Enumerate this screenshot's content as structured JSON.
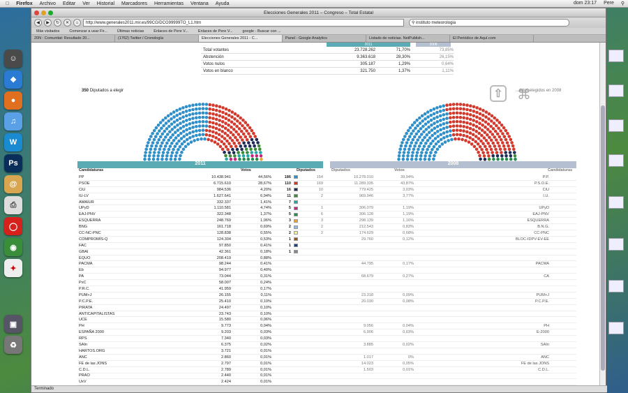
{
  "menubar": {
    "apple": "",
    "app": "Firefox",
    "items": [
      "Archivo",
      "Editar",
      "Ver",
      "Historial",
      "Marcadores",
      "Herramientas",
      "Ventana",
      "Ayuda"
    ],
    "clock": "dom 23:17",
    "user": "Pere"
  },
  "window": {
    "title": "Elecciones Generales 2011 – Congreso – Total Estatal",
    "url": "http://www.generales2011.mir.es/99CG/DCG99999TO_L1.htm",
    "search_value": "instituto meteorologia"
  },
  "bookmarks": [
    "Más visitados",
    "Comenzar a usar Fir...",
    "Últimas noticias",
    "Enlaces de Pere V...",
    "Enlaces de Pere V...",
    "google - Buscar con ..."
  ],
  "tabs": [
    "20N : Comunitat: Resultado 20...",
    "(1762) Twitter / Cronología",
    "Elecciones Generales 2011 - C...",
    "Panel - Google Analytics",
    "Listado de noticias. NetPublish...",
    "El Periódico de Aquí.com"
  ],
  "status": "Terminado",
  "summary": {
    "header_2011": "2011",
    "header_2008": "2008",
    "rows": [
      {
        "label": "Total votantes",
        "votes": "23.728.262",
        "pct": "71,70%",
        "pct08": "73,85%"
      },
      {
        "label": "Abstención",
        "votes": "9.363.618",
        "pct": "28,30%",
        "pct08": "26,15%"
      },
      {
        "label": "Votos nulos",
        "votes": "305.187",
        "pct": "1,29%",
        "pct08": "0,64%"
      },
      {
        "label": "Votos en blanco",
        "votes": "321.750",
        "pct": "1,37%",
        "pct08": "1,11%"
      }
    ]
  },
  "seats_label_num": "350",
  "seats_label_text": "Diputados a elegir",
  "seats_label_2008": "...ados elegidos en 2008",
  "table": {
    "year_2011": "2011",
    "year_2008": "2008",
    "col_party": "Candidaturas",
    "col_votes": "Votos",
    "col_seats": "Diputados",
    "col_seats08": "Diputados",
    "col_votes08": "Votos",
    "col_party08": "Candidaturas",
    "rows": [
      {
        "n": "PP",
        "v": "10.438.941",
        "p": "44,56%",
        "s": "186",
        "c": "#2f8fc9",
        "s8": "154",
        "v8": "10.278.010",
        "p8": "39,94%",
        "n8": "P.P."
      },
      {
        "n": "PSOE",
        "v": "6.715.610",
        "p": "28,67%",
        "s": "110",
        "c": "#d23a2e",
        "s8": "169",
        "v8": "11.289.335",
        "p8": "43,87%",
        "n8": "P.S.O.E."
      },
      {
        "n": "CiU",
        "v": "984.536",
        "p": "4,20%",
        "s": "16",
        "c": "#1d2b55",
        "s8": "10",
        "v8": "779.425",
        "p8": "3,03%",
        "n8": "CiU"
      },
      {
        "n": "IU-LV",
        "v": "1.627.641",
        "p": "6,94%",
        "s": "11",
        "c": "#3b8a38",
        "s8": "2",
        "v8": "969.946",
        "p8": "3,77%",
        "n8": "I.U."
      },
      {
        "n": "AMAIUR",
        "v": "332.337",
        "p": "1,41%",
        "s": "7",
        "c": "#22a6a6",
        "s8": "",
        "v8": "",
        "p8": "",
        "n8": ""
      },
      {
        "n": "UPyD",
        "v": "1.110.581",
        "p": "4,74%",
        "s": "5",
        "c": "#c4267e",
        "s8": "1",
        "v8": "306.079",
        "p8": "1,19%",
        "n8": "UPyD"
      },
      {
        "n": "EAJ-PNV",
        "v": "322.348",
        "p": "1,37%",
        "s": "5",
        "c": "#2a8b50",
        "s8": "6",
        "v8": "306.128",
        "p8": "1,19%",
        "n8": "EAJ-PNV"
      },
      {
        "n": "ESQUERRA",
        "v": "248.769",
        "p": "1,06%",
        "s": "3",
        "c": "#e6a635",
        "s8": "3",
        "v8": "298.139",
        "p8": "1,16%",
        "n8": "ESQUERRA"
      },
      {
        "n": "BNG",
        "v": "161.718",
        "p": "0,69%",
        "s": "2",
        "c": "#8fb9e6",
        "s8": "2",
        "v8": "212.543",
        "p8": "0,83%",
        "n8": "B.N.G."
      },
      {
        "n": "CC-NC-PNC",
        "v": "128.838",
        "p": "0,55%",
        "s": "2",
        "c": "#f2f0a0",
        "s8": "2",
        "v8": "174.629",
        "p8": "0,68%",
        "n8": "CC-PNC"
      },
      {
        "n": "COMPROMÍS-Q",
        "v": "124.304",
        "p": "0,53%",
        "s": "1",
        "c": "#8b5a2b",
        "s8": "",
        "v8": "29.760",
        "p8": "0,12%",
        "n8": "BLOC-IDPV-EV-EE"
      },
      {
        "n": "FAC",
        "v": "97.850",
        "p": "0,41%",
        "s": "1",
        "c": "#1a3f7a",
        "s8": "",
        "v8": "",
        "p8": "",
        "n8": ""
      },
      {
        "n": "GBAI",
        "v": "42.361",
        "p": "0,18%",
        "s": "1",
        "c": "#888888",
        "s8": "",
        "v8": "",
        "p8": "",
        "n8": ""
      },
      {
        "n": "EQUO",
        "v": "208.419",
        "p": "0,88%",
        "s": "",
        "c": "",
        "s8": "",
        "v8": "",
        "p8": "",
        "n8": ""
      },
      {
        "n": "PACMA",
        "v": "98.244",
        "p": "0,41%",
        "s": "",
        "c": "",
        "s8": "",
        "v8": "44.795",
        "p8": "0,17%",
        "n8": "PACMA"
      },
      {
        "n": "Eb",
        "v": "94.977",
        "p": "0,40%",
        "s": "",
        "c": "",
        "s8": "",
        "v8": "",
        "p8": "",
        "n8": ""
      },
      {
        "n": "PA",
        "v": "73.044",
        "p": "0,31%",
        "s": "",
        "c": "",
        "s8": "",
        "v8": "68.679",
        "p8": "0,27%",
        "n8": "CA"
      },
      {
        "n": "PxC",
        "v": "58.007",
        "p": "0,24%",
        "s": "",
        "c": "",
        "s8": "",
        "v8": "",
        "p8": "",
        "n8": ""
      },
      {
        "n": "P.R.C.",
        "v": "41.959",
        "p": "0,17%",
        "s": "",
        "c": "",
        "s8": "",
        "v8": "",
        "p8": "",
        "n8": ""
      },
      {
        "n": "PUM+J",
        "v": "26.155",
        "p": "0,11%",
        "s": "",
        "c": "",
        "s8": "",
        "v8": "23.318",
        "p8": "0,09%",
        "n8": "PUM+J"
      },
      {
        "n": "P.C.P.E.",
        "v": "25.410",
        "p": "0,10%",
        "s": "",
        "c": "",
        "s8": "",
        "v8": "20.030",
        "p8": "0,08%",
        "n8": "P.C.P.E."
      },
      {
        "n": "PIRATA",
        "v": "24.497",
        "p": "0,10%",
        "s": "",
        "c": "",
        "s8": "",
        "v8": "",
        "p8": "",
        "n8": ""
      },
      {
        "n": "ANTICAPITALISTAS",
        "v": "23.743",
        "p": "0,10%",
        "s": "",
        "c": "",
        "s8": "",
        "v8": "",
        "p8": "",
        "n8": ""
      },
      {
        "n": "UCE",
        "v": "15.580",
        "p": "0,06%",
        "s": "",
        "c": "",
        "s8": "",
        "v8": "",
        "p8": "",
        "n8": ""
      },
      {
        "n": "PH",
        "v": "9.773",
        "p": "0,04%",
        "s": "",
        "c": "",
        "s8": "",
        "v8": "9.056",
        "p8": "0,04%",
        "n8": "PH"
      },
      {
        "n": "ESPAÑA 2000",
        "v": "9.203",
        "p": "0,03%",
        "s": "",
        "c": "",
        "s8": "",
        "v8": "6.906",
        "p8": "0,03%",
        "n8": "E-2000"
      },
      {
        "n": "RPS",
        "v": "7.340",
        "p": "0,03%",
        "s": "",
        "c": "",
        "s8": "",
        "v8": "",
        "p8": "",
        "n8": ""
      },
      {
        "n": "SAIn",
        "v": "6.375",
        "p": "0,02%",
        "s": "",
        "c": "",
        "s8": "",
        "v8": "3.885",
        "p8": "0,02%",
        "n8": "SAIn"
      },
      {
        "n": "HARTOS.ORG",
        "v": "3.721",
        "p": "0,01%",
        "s": "",
        "c": "",
        "s8": "",
        "v8": "",
        "p8": "",
        "n8": ""
      },
      {
        "n": "ANC",
        "v": "2.860",
        "p": "0,01%",
        "s": "",
        "c": "",
        "s8": "",
        "v8": "1.017",
        "p8": "0%",
        "n8": "ANC"
      },
      {
        "n": "FE de las JONS",
        "v": "2.797",
        "p": "0,01%",
        "s": "",
        "c": "",
        "s8": "",
        "v8": "14.023",
        "p8": "0,05%",
        "n8": "FE de las JONS"
      },
      {
        "n": "C.D.L.",
        "v": "2.789",
        "p": "0,01%",
        "s": "",
        "c": "",
        "s8": "",
        "v8": "1.503",
        "p8": "0,01%",
        "n8": "C.D.L."
      },
      {
        "n": "PRAO",
        "v": "2.440",
        "p": "0,01%",
        "s": "",
        "c": "",
        "s8": "",
        "v8": "",
        "p8": "",
        "n8": ""
      },
      {
        "n": "UxV",
        "v": "2.424",
        "p": "0,01%",
        "s": "",
        "c": "",
        "s8": "",
        "v8": "",
        "p8": "",
        "n8": ""
      }
    ]
  },
  "hemicycle_2011": [
    {
      "c": "#2f8fc9",
      "n": 186
    },
    {
      "c": "#d23a2e",
      "n": 110
    },
    {
      "c": "#1d2b55",
      "n": 16
    },
    {
      "c": "#3b8a38",
      "n": 11
    },
    {
      "c": "#22a6a6",
      "n": 7
    },
    {
      "c": "#c4267e",
      "n": 5
    },
    {
      "c": "#2a8b50",
      "n": 5
    },
    {
      "c": "#e6a635",
      "n": 3
    },
    {
      "c": "#8fb9e6",
      "n": 2
    },
    {
      "c": "#f2f0a0",
      "n": 2
    },
    {
      "c": "#8b5a2b",
      "n": 1
    },
    {
      "c": "#1a3f7a",
      "n": 1
    },
    {
      "c": "#888888",
      "n": 1
    }
  ],
  "hemicycle_2008": [
    {
      "c": "#2f8fc9",
      "n": 154
    },
    {
      "c": "#d23a2e",
      "n": 169
    },
    {
      "c": "#1d2b55",
      "n": 10
    },
    {
      "c": "#3b8a38",
      "n": 2
    },
    {
      "c": "#2a8b50",
      "n": 6
    },
    {
      "c": "#e6a635",
      "n": 3
    },
    {
      "c": "#8fb9e6",
      "n": 2
    },
    {
      "c": "#f2f0a0",
      "n": 2
    },
    {
      "c": "#c4267e",
      "n": 1
    },
    {
      "c": "#8b5a2b",
      "n": 1
    }
  ],
  "colors": {
    "header_2011": "#5aabb3",
    "header_2008": "#b4bfd1"
  }
}
